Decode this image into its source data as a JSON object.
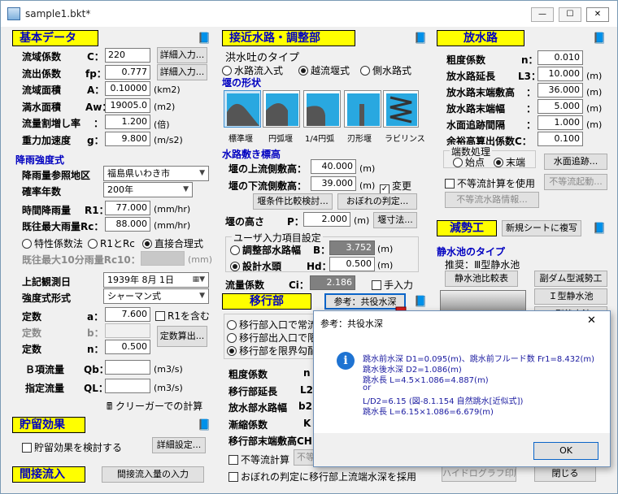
{
  "window": {
    "title": "sample1.bkt*",
    "min": "—",
    "max": "☐",
    "close": "✕"
  },
  "basic": {
    "header": "基本データ",
    "rows": [
      {
        "label": "流域係数",
        "sym": "C：",
        "value": "220",
        "button": "詳細入力..."
      },
      {
        "label": "流出係数",
        "sym": "fp：",
        "value": "0.777",
        "button": "詳細入力..."
      },
      {
        "label": "流域面積",
        "sym": "A：",
        "value": "0.10000",
        "unit": "(km2)"
      },
      {
        "label": "満水面積",
        "sym": "Aw：",
        "value": "19005.0",
        "unit": "(m2)"
      },
      {
        "label": "流量割増し率",
        "sym": "：",
        "value": "1.200",
        "unit": "(倍)"
      },
      {
        "label": "重力加速度",
        "sym": "g：",
        "value": "9.800",
        "unit": "(m/s2)"
      }
    ]
  },
  "rain": {
    "header": "降雨強度式",
    "region_label": "降雨量参照地区",
    "region_value": "福島県いわき市",
    "prob_label": "確率年数",
    "prob_value": "200年",
    "hourly_label": "時間降雨量",
    "hourly_sym": "R1：",
    "hourly_value": "77.000",
    "hourly_unit": "(mm/hr)",
    "max_label": "既往最大雨量Rc：",
    "max_value": "88.000",
    "max_unit": "(mm/hr)",
    "radios": [
      "特性係数法",
      "R1とRc",
      "直接合理式"
    ],
    "tenmin_label": "既往最大10分雨量Rc10：",
    "tenmin_unit": "(mm)",
    "date_label": "上記観測日",
    "date_value": "1939年 8月 1日",
    "formula_label": "強度式形式",
    "formula_value": "シャーマン式",
    "const_a_label": "定数",
    "const_a_sym": "a：",
    "const_a_value": "7.600",
    "r1_check": "R1を含む",
    "const_b_label": "定数",
    "const_b_sym": "b：",
    "const_n_label": "定数",
    "const_n_sym": "n：",
    "const_n_value": "0.500",
    "calc_button": "定数算出...",
    "qb_label": "Ｂ項流量",
    "qb_sym": "Qb：",
    "qb_unit": "(m3/s)",
    "ql_label": "指定流量",
    "ql_sym": "QL：",
    "ql_unit": "(m3/s)",
    "creager_label": "クリーガーでの計算"
  },
  "storage": {
    "header": "貯留効果",
    "check": "貯留効果を検討する",
    "button": "詳細設定..."
  },
  "indirect": {
    "header": "間接流入",
    "button": "間接流入量の入力"
  },
  "approach": {
    "header": "接近水路・調整部",
    "type_title": "洪水吐のタイプ",
    "type_radios": [
      "水路流入式",
      "越流堰式",
      "側水路式"
    ],
    "weir_title": "堰の形状",
    "weirs": [
      "標準堰",
      "円弧堰",
      "1/4円弧",
      "刃形堰",
      "ラビリンス"
    ],
    "crest_title": "水路敷き標高",
    "up_label": "堰の上流側敷高：",
    "up_value": "40.000",
    "up_unit": "(m)",
    "down_label": "堰の下流側敷高：",
    "down_value": "39.000",
    "down_unit": "(m)",
    "change_check": "変更",
    "compare_button": "堰条件比較検討...",
    "estimate_button": "おぼれの判定...",
    "height_label": "堰の高さ",
    "height_sym": "P：",
    "height_value": "2.000",
    "height_unit": "(m)",
    "dim_button": "堰寸法...",
    "user_group": "ユーザ入力項目設定",
    "width_label": "調整部水路幅",
    "width_sym": "B：",
    "width_value": "3.752",
    "width_unit": "(m)",
    "depth_label": "設計水頭",
    "depth_sym": "Hd：",
    "depth_value": "0.500",
    "depth_unit": "(m)",
    "flow_label": "流量係数",
    "flow_sym": "Ci：",
    "flow_value": "2.186",
    "manual_check": "手入力"
  },
  "transition": {
    "header": "移行部",
    "ref_button": "参考：共役水深",
    "radios": [
      "移行部入口で常流",
      "移行部出入口で限",
      "移行部を限界勾配"
    ],
    "rough_label": "粗度係数",
    "rough_sym": "n",
    "len_label": "移行部延長",
    "len_sym": "L2",
    "width_label": "放水部水路幅",
    "width_sym": "b2",
    "coef_label": "漸縮係数",
    "coef_sym": "K",
    "elev_label": "移行部末端敷高CH",
    "uneven_check": "不等流計算",
    "uneven_btn": "不等",
    "bottom_check": "おぼれの判定に移行部上流端水深を採用"
  },
  "outlet": {
    "header": "放水路",
    "rows": [
      {
        "label": "粗度係数",
        "sym": "n：",
        "value": "0.010"
      },
      {
        "label": "放水路延長",
        "sym": "L3：",
        "value": "10.000",
        "unit": "(m)"
      },
      {
        "label": "放水路末端敷高",
        "sym": "：",
        "value": "36.000",
        "unit": "(m)"
      },
      {
        "label": "放水路末端幅",
        "sym": "：",
        "value": "5.000",
        "unit": "(m)"
      },
      {
        "label": "水面追跡間隔",
        "sym": "：",
        "value": "1.000",
        "unit": "(m)"
      },
      {
        "label": "余裕高算出係数C：",
        "sym": "",
        "value": "0.100"
      }
    ],
    "end_group": "端数処理",
    "end_radios": [
      "始点",
      "末端"
    ],
    "trace_button": "水面追跡...",
    "uneven_check": "不等流計算を使用",
    "uneven_button": "不等流起動...",
    "info_button": "不等流水路情報..."
  },
  "energy": {
    "header": "減勢工",
    "copy_button": "新規シートに複写",
    "type_title": "静水池のタイプ",
    "recommend": "推奨：Ⅲ型静水池",
    "compare_button": "静水池比較表",
    "dam_button": "副ダム型減勢工",
    "type1_button": "Ｉ型静水池",
    "type2_button": "Ⅱ型静水池",
    "print_button": "ハイドログラフ印刷...",
    "close_button": "閉じる"
  },
  "dialog": {
    "title": "参考：共役水深",
    "close": "✕",
    "lines": [
      "跳水前水深 D1=0.095(m)、跳水前フルード数 Fr1=8.432(m)",
      "跳水後水深 D2=1.086(m)",
      "跳水長 L=4.5×1.086=4.887(m)",
      "or",
      "L/D2=6.15 (図-8.1.154 自然跳水[近似式])",
      "跳水長 L=6.15×1.086=6.679(m)"
    ],
    "ok": "OK"
  }
}
